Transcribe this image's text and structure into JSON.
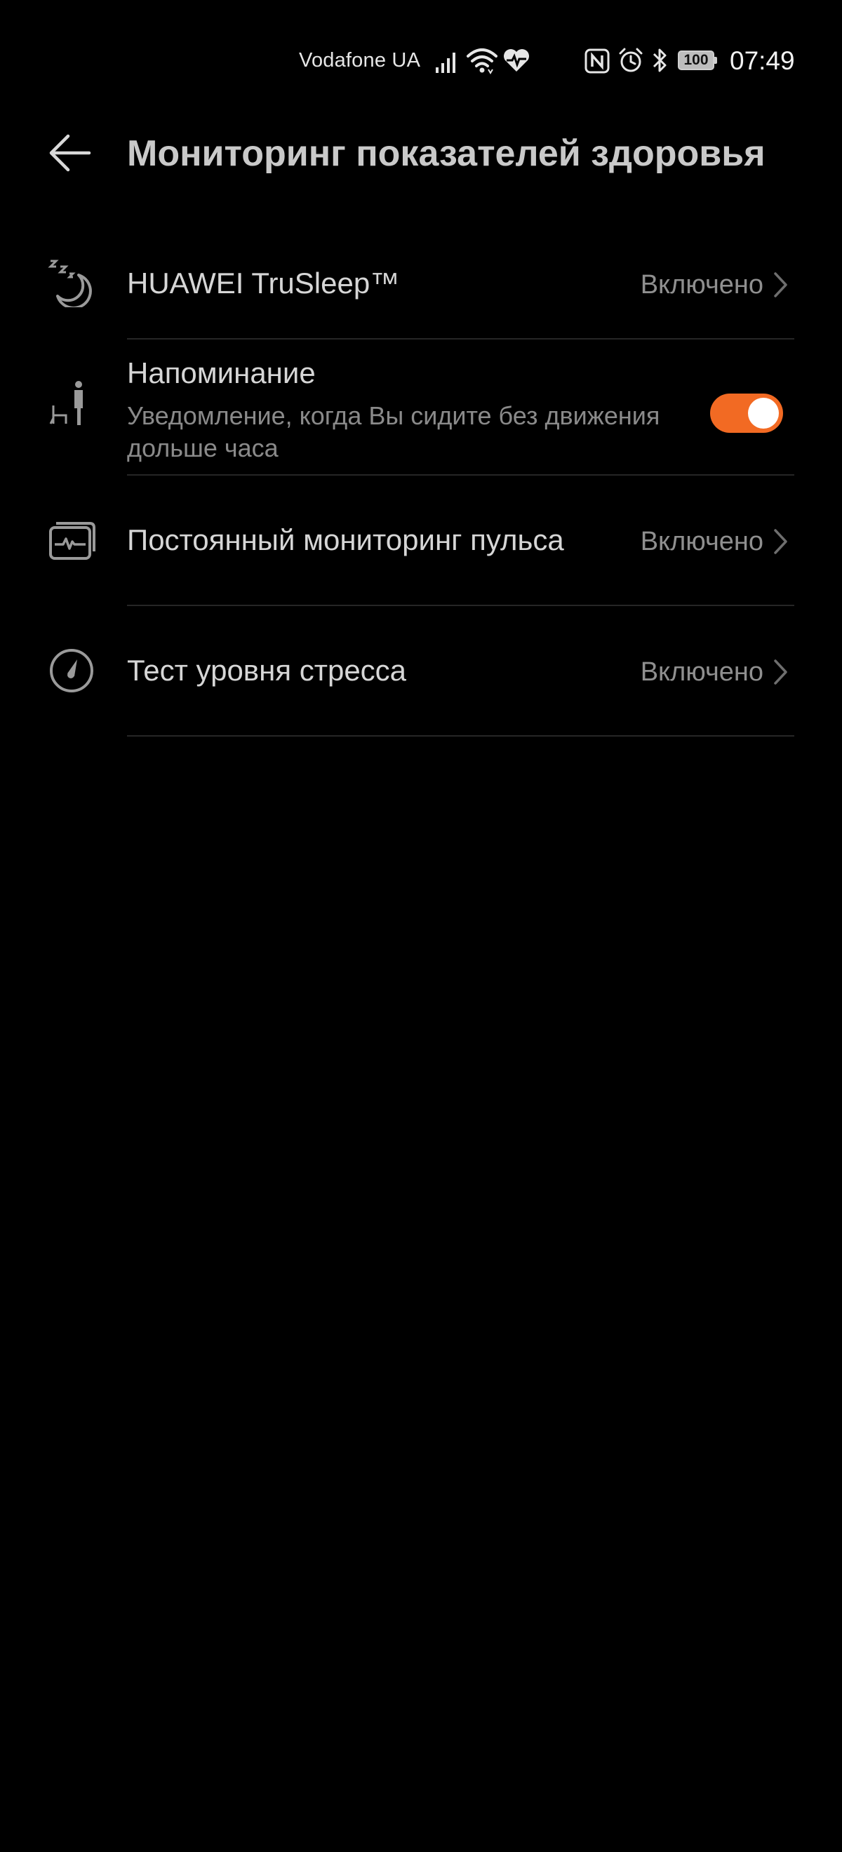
{
  "status_bar": {
    "carrier": "Vodafone UA",
    "battery_level": "100",
    "time": "07:49",
    "icons": [
      "signal-icon",
      "wifi-icon",
      "heart-rate-icon",
      "nfc-icon",
      "alarm-icon",
      "bluetooth-icon",
      "battery-icon"
    ]
  },
  "header": {
    "back_icon": "arrow-left-icon",
    "title": "Мониторинг показателей здоровья"
  },
  "settings": {
    "trusleep": {
      "icon": "sleep-moon-icon",
      "title": "HUAWEI TruSleep™",
      "status": "Включено"
    },
    "reminder": {
      "icon": "sitting-person-icon",
      "title": "Напоминание",
      "subtitle": "Уведомление, когда Вы сидите без движения дольше часа",
      "enabled": true
    },
    "pulse": {
      "icon": "heart-rate-monitor-icon",
      "title": "Постоянный мониторинг пульса",
      "status": "Включено"
    },
    "stress": {
      "icon": "stress-gauge-icon",
      "title": "Тест уровня стресса",
      "status": "Включено"
    }
  },
  "colors": {
    "background": "#000000",
    "accent": "#f26a23",
    "primary_text": "#d6d6d6",
    "secondary_text": "#8a8a8a",
    "divider": "#262626"
  }
}
